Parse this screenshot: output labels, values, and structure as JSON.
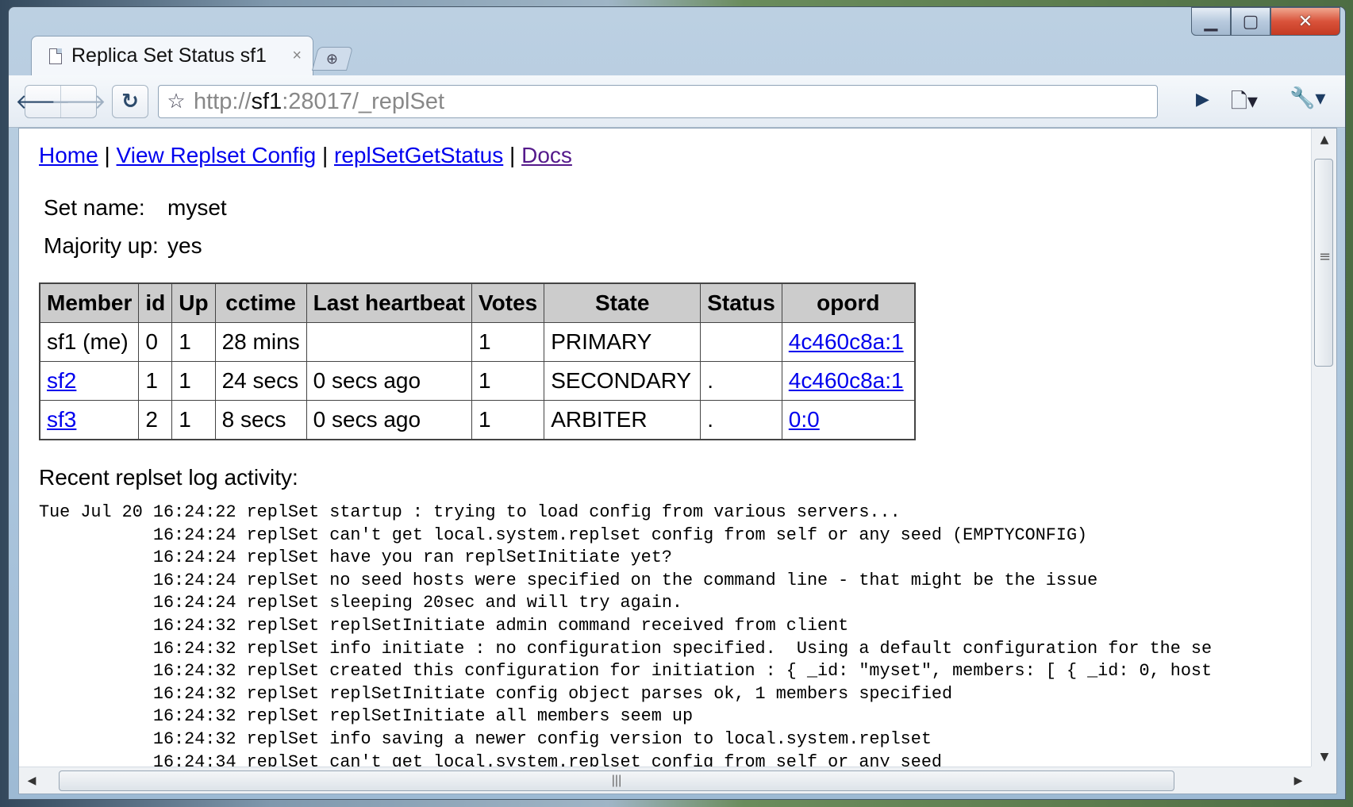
{
  "browser": {
    "tab_title": "Replica Set Status sf1",
    "tab_close": "×",
    "new_tab": "⊕",
    "url_prefix": "http://",
    "url_host": "sf1",
    "url_rest": ":28017/_replSet"
  },
  "nav": {
    "home": "Home",
    "sep": " | ",
    "view_config": "View Replset Config",
    "get_status": "replSetGetStatus",
    "docs": "Docs"
  },
  "info": {
    "set_name_label": "Set name:",
    "set_name_value": "myset",
    "majority_label": "Majority up:",
    "majority_value": "yes"
  },
  "table": {
    "headers": [
      "Member",
      "id",
      "Up",
      "cctime",
      "Last heartbeat",
      "Votes",
      "State",
      "Status",
      "opord"
    ],
    "rows": [
      {
        "member": "sf1 (me)",
        "id": "0",
        "up": "1",
        "cctime": "28 mins",
        "heartbeat": "",
        "votes": "1",
        "state": "PRIMARY",
        "status": "",
        "opord": "4c460c8a:1"
      },
      {
        "member": "sf2",
        "id": "1",
        "up": "1",
        "cctime": "24 secs",
        "heartbeat": "0 secs ago",
        "votes": "1",
        "state": "SECONDARY",
        "status": ".",
        "opord": "4c460c8a:1"
      },
      {
        "member": "sf3",
        "id": "2",
        "up": "1",
        "cctime": "8 secs",
        "heartbeat": "0 secs ago",
        "votes": "1",
        "state": "ARBITER",
        "status": ".",
        "opord": "0:0"
      }
    ]
  },
  "log": {
    "heading": "Recent replset log activity:",
    "lines": [
      "Tue Jul 20 16:24:22 replSet startup : trying to load config from various servers...",
      "           16:24:24 replSet can't get local.system.replset config from self or any seed (EMPTYCONFIG)",
      "           16:24:24 replSet have you ran replSetInitiate yet?",
      "           16:24:24 replSet no seed hosts were specified on the command line - that might be the issue",
      "           16:24:24 replSet sleeping 20sec and will try again.",
      "           16:24:32 replSet replSetInitiate admin command received from client",
      "           16:24:32 replSet info initiate : no configuration specified.  Using a default configuration for the se",
      "           16:24:32 replSet created this configuration for initiation : { _id: \"myset\", members: [ { _id: 0, host",
      "           16:24:32 replSet replSetInitiate config object parses ok, 1 members specified",
      "           16:24:32 replSet replSetInitiate all members seem up",
      "           16:24:32 replSet info saving a newer config version to local.system.replset",
      "           16:24:34 replSet can't get local.system.replset config from self or any seed"
    ]
  },
  "icons": {
    "back": "back-arrow-icon",
    "forward": "forward-arrow-icon",
    "reload": "reload-icon",
    "star": "star-icon",
    "go": "go-arrow-icon",
    "page_menu": "page-menu-icon",
    "wrench": "wrench-icon"
  }
}
